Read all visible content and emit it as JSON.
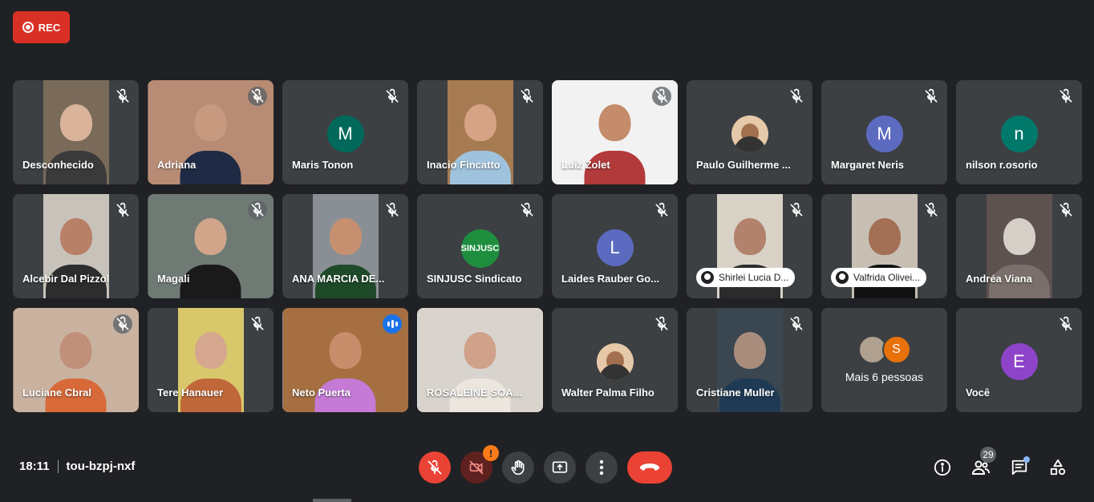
{
  "recording": {
    "label": "REC",
    "color": "#d93025"
  },
  "meeting": {
    "time": "18:11",
    "code": "tou-bzpj-nxf"
  },
  "participants": [
    {
      "name": "Desconhecido",
      "kind": "video",
      "muted": true,
      "video_bg": "#7a6a5a",
      "skin": "#d9b49a",
      "shirt": "#3a3a3a"
    },
    {
      "name": "Adriana",
      "kind": "video-wide",
      "muted": true,
      "video_bg": "#b88c74",
      "skin": "#c79a80",
      "shirt": "#1f2b44"
    },
    {
      "name": "Maris Tonon",
      "kind": "avatar",
      "muted": true,
      "initial": "M",
      "color": "#00695c"
    },
    {
      "name": "Inacio Fincatto",
      "kind": "video",
      "muted": true,
      "video_bg": "#a67b52",
      "skin": "#d7a386",
      "shirt": "#9fc3dd"
    },
    {
      "name": "Luiz Zolet",
      "kind": "video-wide-light",
      "muted": true,
      "video_bg": "#f2f2f2",
      "skin": "#c48c6a",
      "shirt": "#b23a3a"
    },
    {
      "name": "Paulo Guilherme ...",
      "kind": "photo",
      "muted": true
    },
    {
      "name": "Margaret Neris",
      "kind": "avatar",
      "muted": true,
      "initial": "M",
      "color": "#5c6bc0"
    },
    {
      "name": "nilson r.osorio",
      "kind": "avatar",
      "muted": true,
      "initial": "n",
      "color": "#00796b"
    },
    {
      "name": "Alcebir Dal Pizzol",
      "kind": "video",
      "muted": true,
      "video_bg": "#c8c3ba",
      "skin": "#b98068",
      "shirt": "#2d2d2d"
    },
    {
      "name": "Magali",
      "kind": "video-wide",
      "muted": true,
      "video_bg": "#6e7a73",
      "skin": "#d0a58a",
      "shirt": "#1a1a1a"
    },
    {
      "name": "ANA MARCIA DE...",
      "kind": "video",
      "muted": true,
      "video_bg": "#8a8f96",
      "skin": "#c69070",
      "shirt": "#1f4a2a"
    },
    {
      "name": "SINJUSC Sindicato",
      "kind": "logo",
      "muted": true,
      "initial": "SINJUSC",
      "color": "#1e8e3e"
    },
    {
      "name": "Laides Rauber Go...",
      "kind": "avatar",
      "muted": true,
      "initial": "L",
      "color": "#5c6bc0"
    },
    {
      "name": "Shirlei Lucia D...",
      "kind": "video-pill",
      "muted": true,
      "video_bg": "#d8d2c7",
      "skin": "#b2826c",
      "shirt": "#2b2b2b"
    },
    {
      "name": "Valfrida Olivei...",
      "kind": "video-pill",
      "muted": true,
      "video_bg": "#c7bfb3",
      "skin": "#a36f55",
      "shirt": "#111111"
    },
    {
      "name": "Andréa Viana",
      "kind": "video",
      "muted": true,
      "video_bg": "#5d5250",
      "skin": "#d6cfc7",
      "shirt": "#7a6f6a"
    },
    {
      "name": "Luciane Cbral",
      "kind": "video-wide",
      "muted": true,
      "video_bg": "#c9b2a0",
      "skin": "#c09078",
      "shirt": "#d86a3a"
    },
    {
      "name": "Tere Hanauer",
      "kind": "video",
      "muted": true,
      "video_bg": "#d9c86b",
      "skin": "#d5a78f",
      "shirt": "#c0683a"
    },
    {
      "name": "Neto Puerta",
      "kind": "video-wide-active",
      "muted": false,
      "speaking": true,
      "video_bg": "#a56f42",
      "skin": "#c88e6c",
      "shirt": "#c57ad6"
    },
    {
      "name": "ROSALEINE SOA...",
      "kind": "video-wide-light",
      "muted": false,
      "video_bg": "#d8d4cd",
      "skin": "#d0a28a",
      "shirt": "#ece6df"
    },
    {
      "name": "Walter Palma Filho",
      "kind": "photo",
      "muted": true
    },
    {
      "name": "Cristiane Muller",
      "kind": "video",
      "muted": true,
      "video_bg": "#3a4650",
      "skin": "#a88c7c",
      "shirt": "#1f3a55"
    },
    {
      "name": "",
      "kind": "more",
      "muted": false,
      "label": "Mais 6 pessoas",
      "initial": "S",
      "color": "#e8710a"
    },
    {
      "name": "Você",
      "kind": "avatar",
      "muted": true,
      "initial": "E",
      "color": "#8e44c9"
    }
  ],
  "participants_count": "29",
  "icons": {
    "mic": "mic-off-icon",
    "camera": "camera-off-icon",
    "hand": "raise-hand-icon",
    "present": "present-screen-icon",
    "more": "more-options-icon",
    "hangup": "hang-up-icon",
    "info": "info-icon",
    "people": "people-icon",
    "chat": "chat-icon",
    "activities": "activities-icon"
  },
  "camera_warning": "!"
}
